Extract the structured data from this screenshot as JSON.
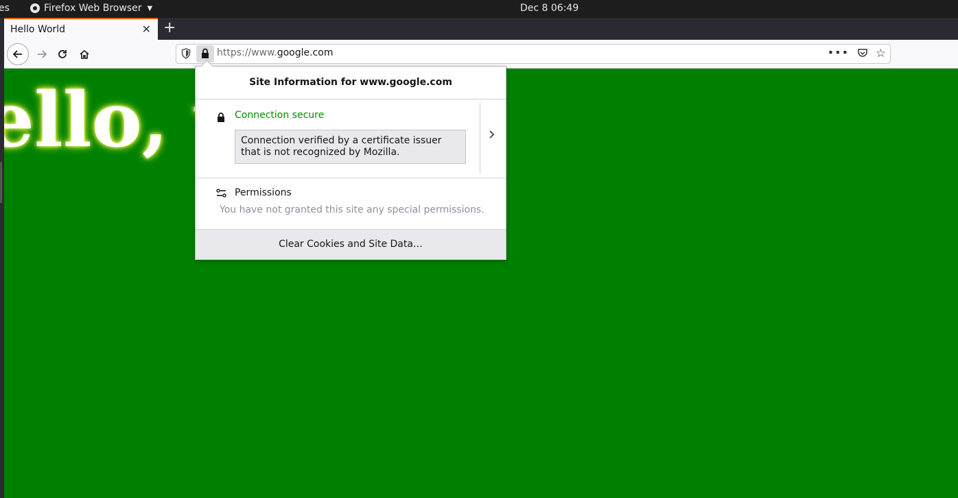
{
  "system_bar": {
    "activities": "es",
    "app_name": "Firefox Web Browser",
    "clock": "Dec 8  06:49"
  },
  "tabs": [
    {
      "title": "Hello World"
    }
  ],
  "toolbar": {
    "url_scheme": "https://www.",
    "url_domain": "google.com",
    "more_label": "•••"
  },
  "page": {
    "heading": "Hello, world!",
    "background_color": "#008000",
    "heading_color": "#ffffff"
  },
  "site_info_popup": {
    "title": "Site Information for www.google.com",
    "connection_status": "Connection secure",
    "connection_detail": "Connection verified by a certificate issuer that is not recognized by Mozilla.",
    "permissions_title": "Permissions",
    "permissions_detail": "You have not granted this site any special permissions.",
    "clear_button": "Clear Cookies and Site Data…",
    "status_color": "#058b00"
  }
}
